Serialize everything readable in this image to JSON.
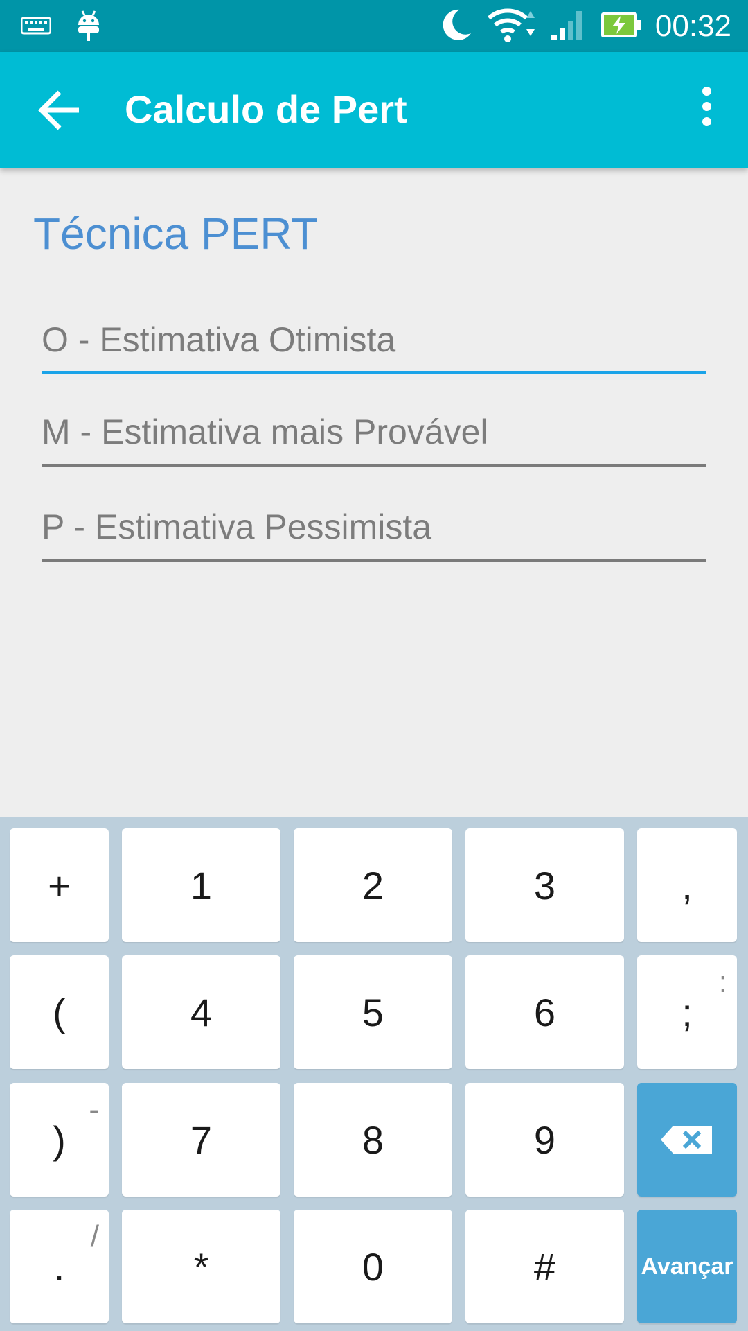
{
  "status_bar": {
    "time": "00:32",
    "icons": [
      "keyboard-icon",
      "android-icon",
      "moon-icon",
      "wifi-icon",
      "signal-icon",
      "battery-charging-icon"
    ]
  },
  "app_bar": {
    "title": "Calculo de Pert",
    "back_icon": "arrow-back-icon",
    "menu_icon": "more-vert-icon"
  },
  "main": {
    "section_title": "Técnica PERT",
    "fields": [
      {
        "placeholder": "O - Estimativa Otimista",
        "value": "",
        "focused": true
      },
      {
        "placeholder": "M - Estimativa mais Provável",
        "value": "",
        "focused": false
      },
      {
        "placeholder": "P - Estimativa Pessimista",
        "value": "",
        "focused": false
      }
    ]
  },
  "keyboard": {
    "rows": [
      [
        "+",
        "1",
        "2",
        "3",
        ","
      ],
      [
        "(",
        "4",
        "5",
        "6",
        ";"
      ],
      [
        ")",
        "7",
        "8",
        "9",
        "⌫"
      ],
      [
        ".",
        "*",
        "0",
        "#",
        "Avançar"
      ]
    ],
    "hints": {
      "semicolon": ":",
      "close_paren": "-",
      "period": "/"
    },
    "colors": {
      "background": "#bccfdc",
      "key": "#ffffff",
      "action_key": "#4aa6d6"
    }
  },
  "colors": {
    "status_bar": "#0095a8",
    "app_bar": "#00bcd4",
    "section_title": "#4c8fd2",
    "focus_underline": "#1aa3e8"
  }
}
